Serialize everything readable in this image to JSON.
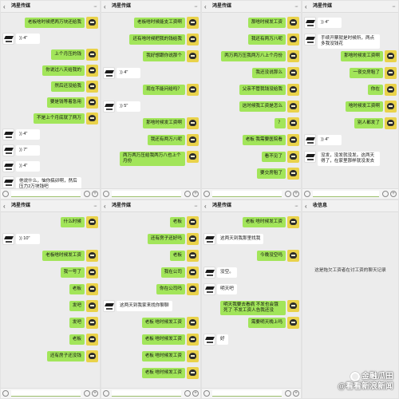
{
  "screens": [
    {
      "title": "鸿星传媒",
      "messages": [
        {
          "who": "me",
          "text": "老板啥时候把两万块还给我"
        },
        {
          "who": "other",
          "voice": true,
          "text": "4\""
        },
        {
          "who": "me",
          "text": "上个月压的钱"
        },
        {
          "who": "me",
          "text": "你说过八天给我的"
        },
        {
          "who": "me",
          "text": "然后还没给我"
        },
        {
          "who": "me",
          "text": "要是钱等着急用"
        },
        {
          "who": "me",
          "text": "不是上个月底就了两万"
        },
        {
          "who": "other",
          "voice": true,
          "text": "4\""
        },
        {
          "who": "other",
          "voice": true,
          "text": "7\""
        },
        {
          "who": "other",
          "voice": true,
          "text": "4\""
        },
        {
          "who": "other",
          "text": "他说什么，恼你搞卯啊，然后压力2万块钱吧"
        }
      ]
    },
    {
      "title": "鸿星传媒",
      "messages": [
        {
          "who": "me",
          "text": "老板啥时候能支工资啊"
        },
        {
          "who": "me",
          "text": "还有啥时候把我的钱给我"
        },
        {
          "who": "me",
          "text": "我好想跟你说那个"
        },
        {
          "who": "other",
          "voice": true,
          "text": "4\""
        },
        {
          "who": "me",
          "text": "现在不能问给吗？"
        },
        {
          "who": "other",
          "voice": true,
          "text": "5\""
        },
        {
          "who": "me",
          "text": "那啥时候发工资啊"
        },
        {
          "who": "me",
          "text": "我还有两万八呢"
        },
        {
          "who": "me",
          "text": "两万两万压给我两万八也上个月份"
        }
      ]
    },
    {
      "title": "鸿星传媒",
      "messages": [
        {
          "who": "me",
          "text": "那啥时候发工资"
        },
        {
          "who": "me",
          "text": "我还有两万八呢"
        },
        {
          "who": "me",
          "text": "两万两万压我两万八上个月份"
        },
        {
          "who": "me",
          "text": "我还没说那么"
        },
        {
          "who": "me",
          "text": "父亲不管我钱没给我"
        },
        {
          "who": "me",
          "text": "这时候我工资是怎么"
        },
        {
          "who": "me",
          "text": "？"
        },
        {
          "who": "me",
          "text": "老板 我需要医院看"
        },
        {
          "who": "me",
          "text": "看不见了"
        },
        {
          "who": "me",
          "text": "要交房租了"
        }
      ]
    },
    {
      "title": "鸿星传媒",
      "messages": [
        {
          "who": "other",
          "voice": true,
          "text": "4\""
        },
        {
          "who": "other",
          "text": "手续开票就是时候所，两点多我没钱花"
        },
        {
          "who": "me",
          "text": "那啥时候发工资啊"
        },
        {
          "who": "me",
          "text": "一夜交房租了"
        },
        {
          "who": "me",
          "text": "你在"
        },
        {
          "who": "me",
          "text": "啥时候发工资啊"
        },
        {
          "who": "me",
          "text": "别人都发了"
        },
        {
          "who": "other",
          "voice": true,
          "text": "4\""
        },
        {
          "who": "other",
          "text": "没发，没发就没发。这两天得了，在家里那样就没发去"
        }
      ]
    },
    {
      "title": "鸿星传媒",
      "messages": [
        {
          "who": "me",
          "text": "什么时候"
        },
        {
          "who": "other",
          "voice": true,
          "text": "10\""
        },
        {
          "who": "me",
          "text": "老板啥时候发工资"
        },
        {
          "who": "me",
          "text": "我一号了"
        },
        {
          "who": "me",
          "text": "老板"
        },
        {
          "who": "me",
          "text": "发吧"
        },
        {
          "who": "me",
          "text": "发吧"
        },
        {
          "who": "me",
          "text": "老板"
        },
        {
          "who": "me",
          "text": "还有房子还没钱"
        }
      ]
    },
    {
      "title": "鸿星传媒",
      "messages": [
        {
          "who": "me",
          "text": "老板"
        },
        {
          "who": "me",
          "text": "还有房子还好吗"
        },
        {
          "who": "me",
          "text": "老板"
        },
        {
          "who": "me",
          "text": "我在公司"
        },
        {
          "who": "me",
          "text": "你在公司吗"
        },
        {
          "who": "other",
          "text": "这两天到我家来找你聊聊"
        },
        {
          "who": "me",
          "text": "老板 啥时候发工资"
        },
        {
          "who": "me",
          "text": "老板 啥时候发工资"
        },
        {
          "who": "me",
          "text": "老板 啥时候发工资"
        },
        {
          "who": "me",
          "text": "老板 啥时候发工资"
        }
      ]
    },
    {
      "title": "鸿星传媒",
      "messages": [
        {
          "who": "me",
          "text": "老板 啥时候发工资"
        },
        {
          "who": "other",
          "text": "这两天到我那里找我"
        },
        {
          "who": "me",
          "text": "今晚没空吗"
        },
        {
          "who": "other",
          "text": "没空。"
        },
        {
          "who": "other",
          "text": "明天吧"
        },
        {
          "who": "me",
          "text": "明天我要去看病 不发也会饿死了 不发工资人告我还没"
        },
        {
          "who": "me",
          "text": "需要明天晚上吗"
        },
        {
          "who": "other",
          "text": "好"
        }
      ]
    }
  ],
  "final_screen": {
    "back_label": "收信息",
    "system_text": "这是拖欠工资者在讨工资的聊天记录"
  },
  "watermark": {
    "line1": "金融瓜田",
    "line2": "@看看新浪新闻"
  },
  "colors": {
    "bubble_me": "#a2e55a",
    "bubble_other": "#ffffff",
    "chat_bg": "#ececec",
    "header_bg": "#f1f1f1"
  }
}
